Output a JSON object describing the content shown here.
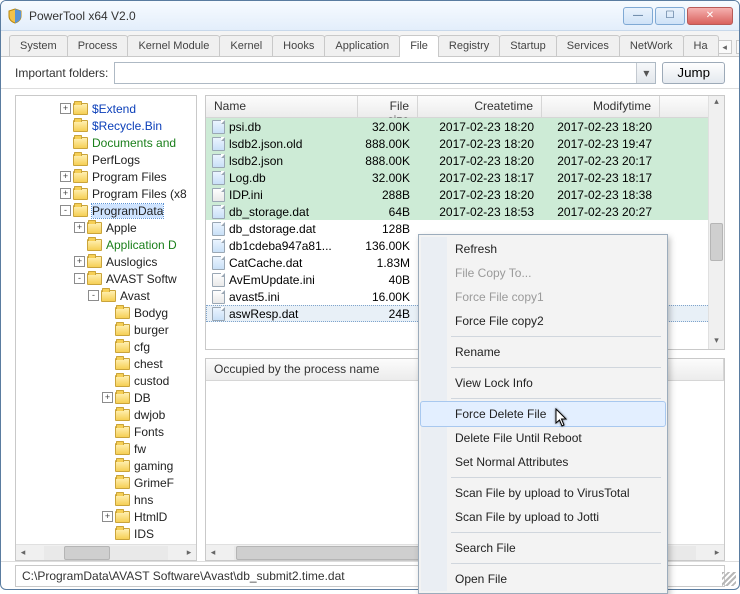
{
  "window": {
    "title": "PowerTool x64 V2.0"
  },
  "tabs": [
    "System",
    "Process",
    "Kernel Module",
    "Kernel",
    "Hooks",
    "Application",
    "File",
    "Registry",
    "Startup",
    "Services",
    "NetWork",
    "Ha"
  ],
  "active_tab": "File",
  "toolbar": {
    "label": "Important folders:",
    "jump": "Jump"
  },
  "tree": [
    {
      "lvl": 3,
      "exp": "+",
      "txt": "$Extend",
      "cls": "blue"
    },
    {
      "lvl": 3,
      "exp": "",
      "txt": "$Recycle.Bin",
      "cls": "blue"
    },
    {
      "lvl": 3,
      "exp": "",
      "txt": "Documents and",
      "cls": "green"
    },
    {
      "lvl": 3,
      "exp": "",
      "txt": "PerfLogs",
      "cls": ""
    },
    {
      "lvl": 3,
      "exp": "+",
      "txt": "Program Files",
      "cls": ""
    },
    {
      "lvl": 3,
      "exp": "+",
      "txt": "Program Files (x8",
      "cls": ""
    },
    {
      "lvl": 3,
      "exp": "-",
      "txt": "ProgramData",
      "cls": "",
      "sel": true
    },
    {
      "lvl": 4,
      "exp": "+",
      "txt": "Apple",
      "cls": ""
    },
    {
      "lvl": 4,
      "exp": "",
      "txt": "Application D",
      "cls": "green"
    },
    {
      "lvl": 4,
      "exp": "+",
      "txt": "Auslogics",
      "cls": ""
    },
    {
      "lvl": 4,
      "exp": "-",
      "txt": "AVAST Softw",
      "cls": ""
    },
    {
      "lvl": 5,
      "exp": "-",
      "txt": "Avast",
      "cls": ""
    },
    {
      "lvl": 6,
      "exp": "",
      "txt": "Bodyg",
      "cls": ""
    },
    {
      "lvl": 6,
      "exp": "",
      "txt": "burger",
      "cls": ""
    },
    {
      "lvl": 6,
      "exp": "",
      "txt": "cfg",
      "cls": ""
    },
    {
      "lvl": 6,
      "exp": "",
      "txt": "chest",
      "cls": ""
    },
    {
      "lvl": 6,
      "exp": "",
      "txt": "custod",
      "cls": ""
    },
    {
      "lvl": 6,
      "exp": "+",
      "txt": "DB",
      "cls": ""
    },
    {
      "lvl": 6,
      "exp": "",
      "txt": "dwjob",
      "cls": ""
    },
    {
      "lvl": 6,
      "exp": "",
      "txt": "Fonts",
      "cls": ""
    },
    {
      "lvl": 6,
      "exp": "",
      "txt": "fw",
      "cls": ""
    },
    {
      "lvl": 6,
      "exp": "",
      "txt": "gaming",
      "cls": ""
    },
    {
      "lvl": 6,
      "exp": "",
      "txt": "GrimeF",
      "cls": ""
    },
    {
      "lvl": 6,
      "exp": "",
      "txt": "hns",
      "cls": ""
    },
    {
      "lvl": 6,
      "exp": "+",
      "txt": "HtmlD",
      "cls": ""
    },
    {
      "lvl": 6,
      "exp": "",
      "txt": "IDS",
      "cls": ""
    }
  ],
  "columns": {
    "name": "Name",
    "size": "File size",
    "ctime": "Createtime",
    "mtime": "Modifytime"
  },
  "files": [
    {
      "g": 1,
      "ic": "db",
      "name": "psi.db",
      "size": "32.00K",
      "c": "2017-02-23 18:20",
      "m": "2017-02-23 18:20"
    },
    {
      "g": 1,
      "ic": "db",
      "name": "lsdb2.json.old",
      "size": "888.00K",
      "c": "2017-02-23 18:20",
      "m": "2017-02-23 19:47"
    },
    {
      "g": 1,
      "ic": "db",
      "name": "lsdb2.json",
      "size": "888.00K",
      "c": "2017-02-23 18:20",
      "m": "2017-02-23 20:17"
    },
    {
      "g": 1,
      "ic": "db",
      "name": "Log.db",
      "size": "32.00K",
      "c": "2017-02-23 18:17",
      "m": "2017-02-23 18:17"
    },
    {
      "g": 1,
      "ic": "ini",
      "name": "IDP.ini",
      "size": "288B",
      "c": "2017-02-23 18:20",
      "m": "2017-02-23 18:38"
    },
    {
      "g": 1,
      "ic": "db",
      "name": "db_storage.dat",
      "size": "64B",
      "c": "2017-02-23 18:53",
      "m": "2017-02-23 20:27"
    },
    {
      "g": 0,
      "ic": "db",
      "name": "db_dstorage.dat",
      "size": "128B",
      "c": "",
      "m": ""
    },
    {
      "g": 0,
      "ic": "db",
      "name": "db1cdeba947a81...",
      "size": "136.00K",
      "c": "",
      "m": ""
    },
    {
      "g": 0,
      "ic": "db",
      "name": "CatCache.dat",
      "size": "1.83M",
      "c": "",
      "m": ""
    },
    {
      "g": 0,
      "ic": "ini",
      "name": "AvEmUpdate.ini",
      "size": "40B",
      "c": "",
      "m": ""
    },
    {
      "g": 0,
      "ic": "ini",
      "name": "avast5.ini",
      "size": "16.00K",
      "c": "",
      "m": ""
    },
    {
      "g": 0,
      "ic": "db",
      "name": "aswResp.dat",
      "size": "24B",
      "c": "",
      "m": "",
      "sel": true
    }
  ],
  "occ_header": "Occupied by the process name",
  "status_path": "C:\\ProgramData\\AVAST Software\\Avast\\db_submit2.time.dat",
  "ctx": {
    "refresh": "Refresh",
    "copyto": "File Copy To...",
    "fc1": "Force File copy1",
    "fc2": "Force File copy2",
    "rename": "Rename",
    "lock": "View Lock Info",
    "fdel": "Force Delete File",
    "dreboot": "Delete File Until Reboot",
    "setattr": "Set Normal Attributes",
    "vt": "Scan File by upload to VirusTotal",
    "jotti": "Scan File by upload to Jotti",
    "search": "Search File",
    "open": "Open File"
  }
}
